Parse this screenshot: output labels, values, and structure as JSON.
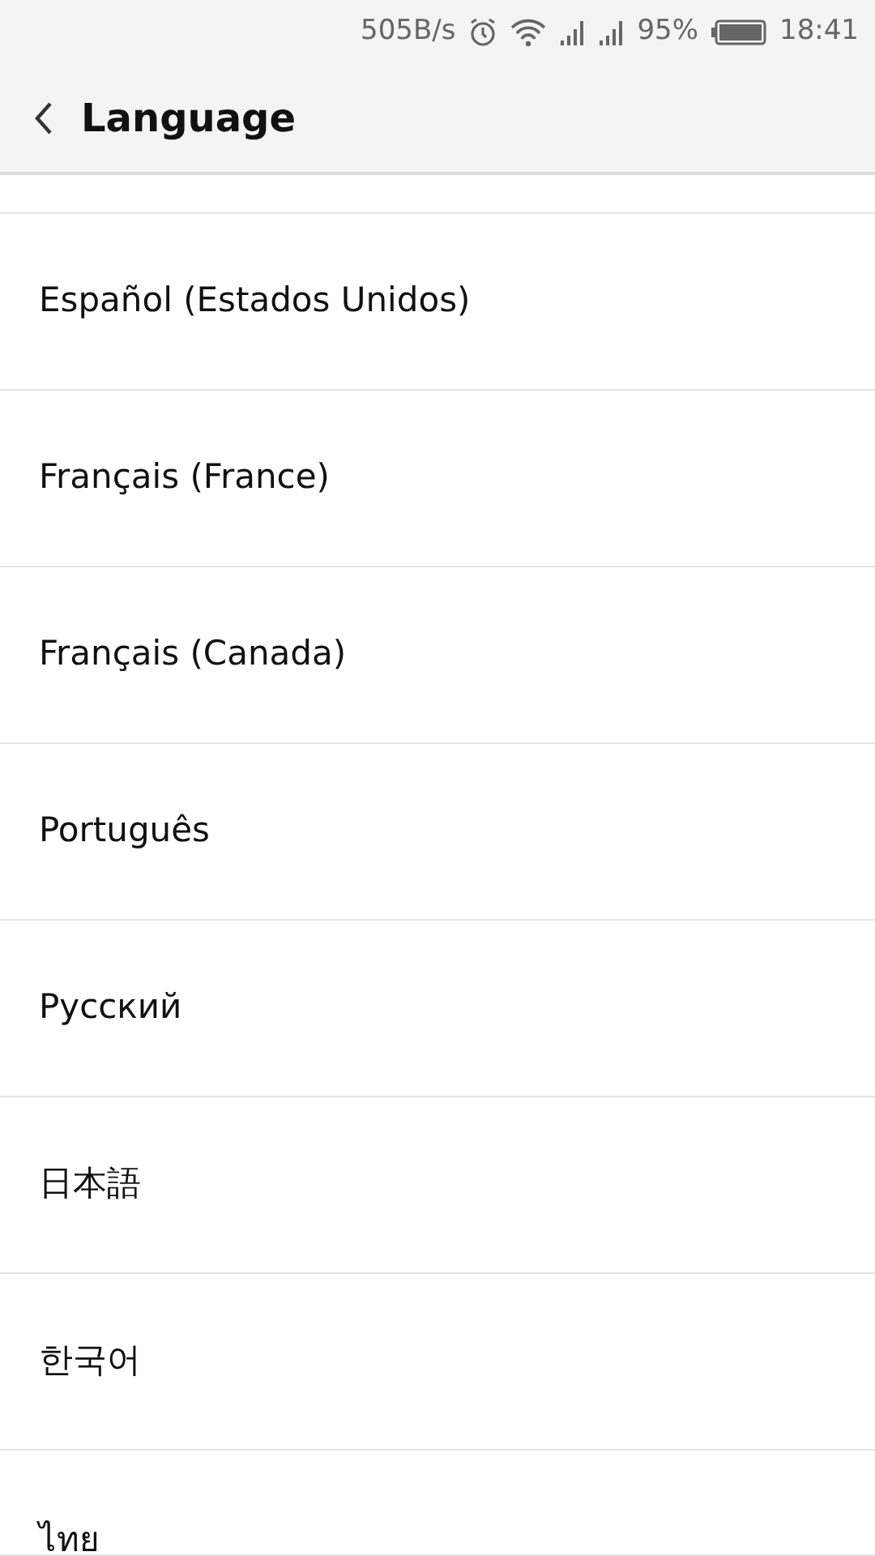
{
  "status_bar": {
    "speed": "505B/s",
    "battery": "95%",
    "time": "18:41"
  },
  "header": {
    "title": "Language"
  },
  "languages": [
    {
      "label": "Español (Estados Unidos)"
    },
    {
      "label": "Français (France)"
    },
    {
      "label": "Français (Canada)"
    },
    {
      "label": "Português"
    },
    {
      "label": "Русский"
    },
    {
      "label": "日本語"
    },
    {
      "label": "한국어"
    },
    {
      "label": "ไทย"
    }
  ]
}
